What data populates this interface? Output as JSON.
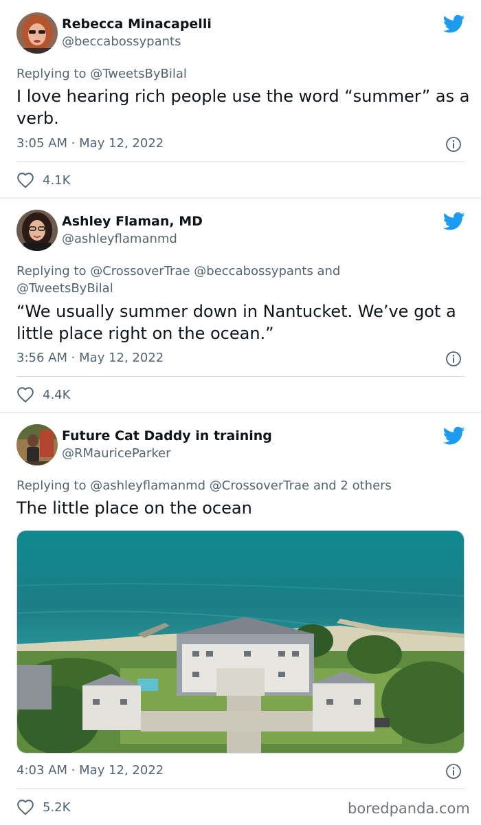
{
  "tweets": [
    {
      "name": "Rebecca Minacapelli",
      "handle": "@beccabossypants",
      "reply_prefix": "Replying to",
      "reply_to": "@TweetsByBilal",
      "text": "I love hearing rich people use the word “summer” as a verb.",
      "timestamp": "3:05 AM · May 12, 2022",
      "likes": "4.1K"
    },
    {
      "name": "Ashley Flaman, MD",
      "handle": "@ashleyflamanmd",
      "reply_prefix": "Replying to",
      "reply_to": "@CrossoverTrae @beccabossypants and @TweetsByBilal",
      "text": "“We usually summer down in Nantucket. We’ve got a little place right on the ocean.”",
      "timestamp": "3:56 AM · May 12, 2022",
      "likes": "4.4K"
    },
    {
      "name": "Future Cat Daddy in training",
      "handle": "@RMauriceParker",
      "reply_prefix": "Replying to",
      "reply_to": "@ashleyflamanmd @CrossoverTrae and 2 others",
      "text": "The little place on the ocean",
      "timestamp": "4:03 AM · May 12, 2022",
      "likes": "5.2K"
    }
  ],
  "icons": {
    "platform": "twitter-bird-icon",
    "info": "info-icon",
    "like": "heart-icon"
  },
  "colors": {
    "brand_blue": "#1d9bf0",
    "text_primary": "#0f1419",
    "text_secondary": "#536471",
    "divider": "#cfd9de",
    "page_background": "#e6ecf0"
  },
  "watermark": "boredpanda.com"
}
